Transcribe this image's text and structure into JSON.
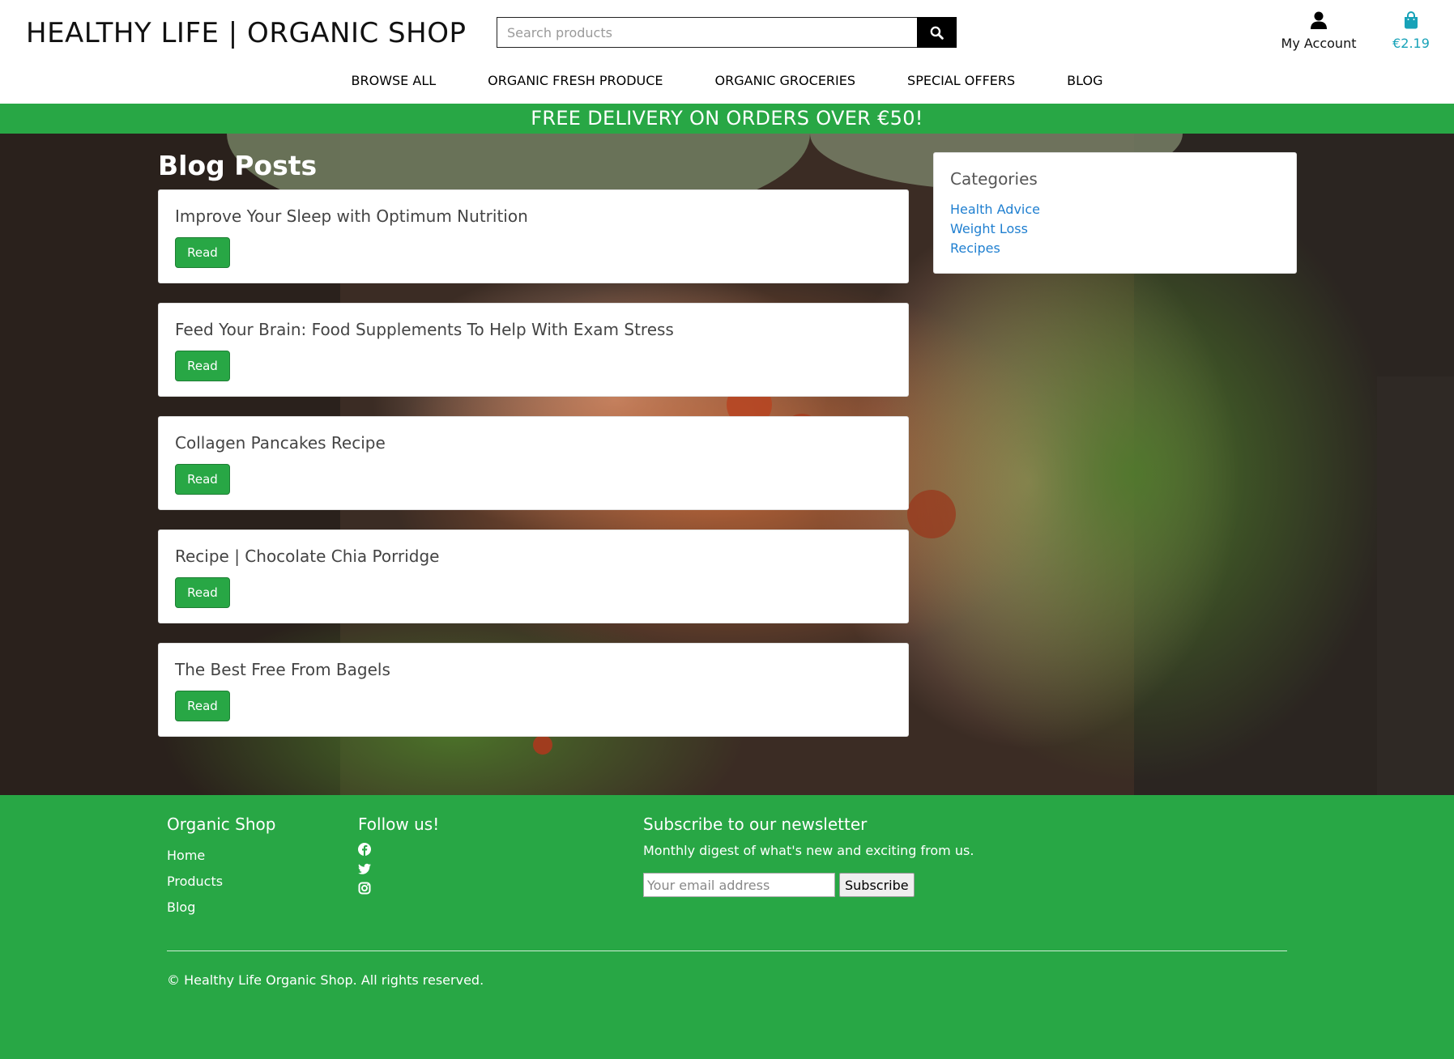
{
  "header": {
    "logo": "HEALTHY LIFE | ORGANIC SHOP",
    "search_placeholder": "Search products",
    "search_icon": "search-icon",
    "account_label": "My Account",
    "account_icon": "user-icon",
    "cart_total": "€2.19",
    "cart_icon": "shopping-bag-icon",
    "accent_color": "#17a2b8"
  },
  "nav": {
    "items": [
      {
        "label": "BROWSE ALL"
      },
      {
        "label": "ORGANIC FRESH PRODUCE"
      },
      {
        "label": "ORGANIC GROCERIES"
      },
      {
        "label": "SPECIAL OFFERS"
      },
      {
        "label": "BLOG"
      }
    ]
  },
  "banner": {
    "text": "FREE DELIVERY ON ORDERS OVER €50!",
    "color": "#28a745"
  },
  "blog": {
    "title": "Blog Posts",
    "posts": [
      {
        "title": "Improve Your Sleep with Optimum Nutrition",
        "button": "Read"
      },
      {
        "title": "Feed Your Brain: Food Supplements To Help With Exam Stress",
        "button": "Read"
      },
      {
        "title": "Collagen Pancakes Recipe",
        "button": "Read"
      },
      {
        "title": "Recipe | Chocolate Chia Porridge",
        "button": "Read"
      },
      {
        "title": "The Best Free From Bagels",
        "button": "Read"
      }
    ]
  },
  "categories": {
    "title": "Categories",
    "items": [
      {
        "label": "Health Advice"
      },
      {
        "label": "Weight Loss"
      },
      {
        "label": "Recipes"
      }
    ]
  },
  "footer": {
    "shop_title": "Organic Shop",
    "links": [
      {
        "label": "Home"
      },
      {
        "label": "Products"
      },
      {
        "label": "Blog"
      }
    ],
    "follow_title": "Follow us!",
    "social_icons": [
      "facebook-icon",
      "twitter-icon",
      "instagram-icon"
    ],
    "newsletter_title": "Subscribe to our newsletter",
    "newsletter_desc": "Monthly digest of what's new and exciting from us.",
    "email_placeholder": "Your email address",
    "subscribe_label": "Subscribe",
    "copyright": "© Healthy Life Organic Shop. All rights reserved."
  }
}
